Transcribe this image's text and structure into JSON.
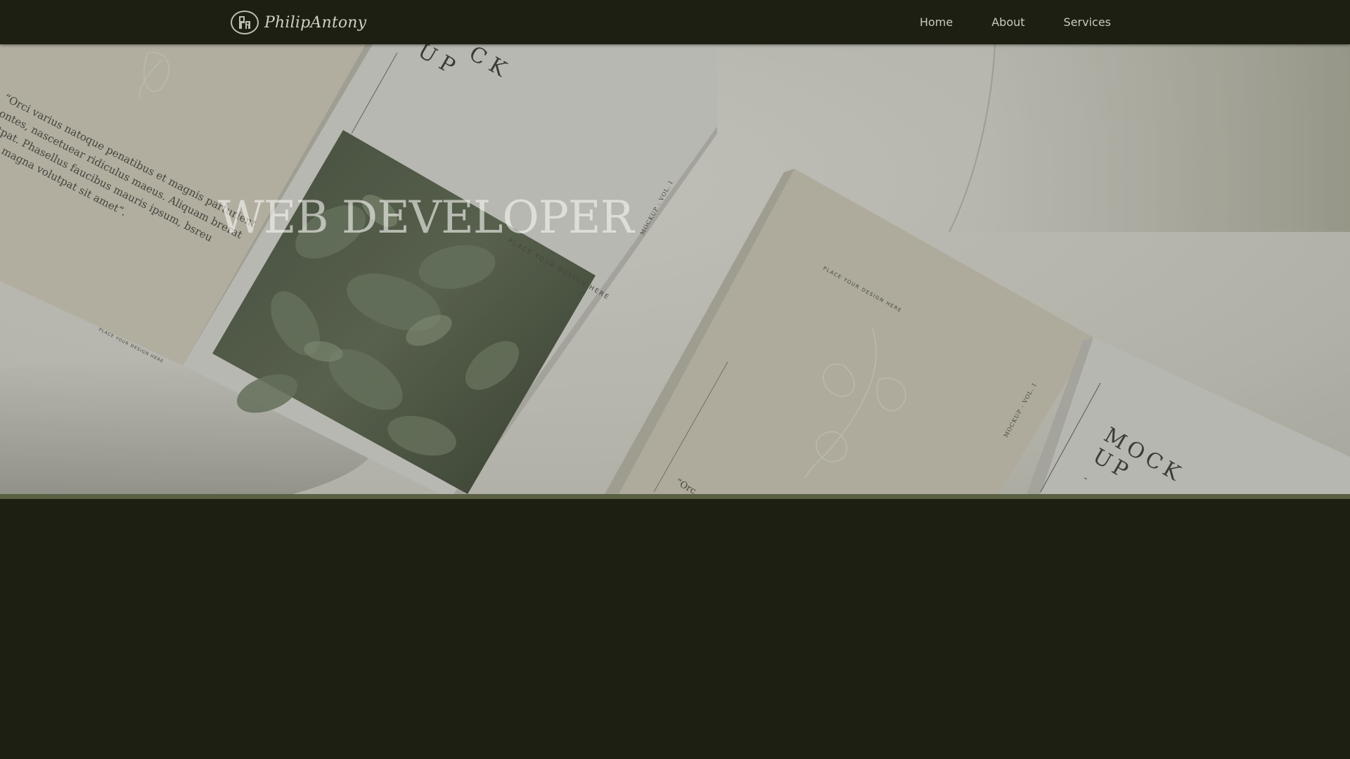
{
  "brand": {
    "name": "PhilipAntony",
    "logo_icon": "pa-monogram-icon"
  },
  "nav": {
    "items": [
      {
        "label": "Home"
      },
      {
        "label": "About"
      },
      {
        "label": "Services"
      }
    ]
  },
  "hero": {
    "title": "WEB DEVELOPER",
    "mockup_text": {
      "quote_left": [
        "“Orci varius natoque penatibus et magnis parturient",
        "montes, nascetuear ridiculus maeus. Aliquam brerat",
        "volutpat.  Phasellus  faucibus  mauris  ipsum,  bsreu",
        "semper magna volutpat sit amet”."
      ],
      "place_design_1": "PLACE YOUR DESIGN HERE",
      "place_design_2": "PLACE YOUR DESIGN HERE",
      "place_design_3": "PLACE YOUR DESIGN HERE",
      "mockup_vol_1": "MOCKUP - VOL. I",
      "mockup_vol_2": "MOCKUP - VOL. I",
      "mock_up_heading": [
        "MOCK",
        "UP",
        "-"
      ],
      "quote_bottom": "“Orc"
    }
  },
  "colors": {
    "nav_bg": "#1e1f13",
    "nav_text": "#c9c9c1",
    "accent_bar": "#596044",
    "page_bg": "#1e1f13"
  }
}
